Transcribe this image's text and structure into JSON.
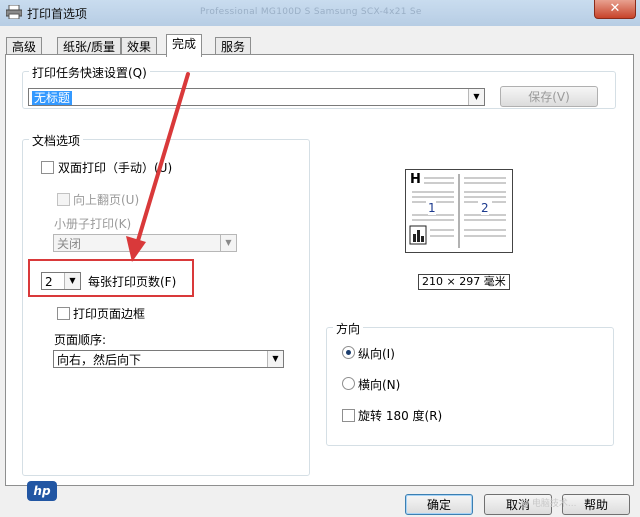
{
  "window": {
    "title": "打印首选项",
    "ghost_text": "Professional MG100D     S Samsung SCX-4x21 Se",
    "close_label": "✕"
  },
  "tabs": [
    {
      "label": "高级"
    },
    {
      "label": "纸张/质量"
    },
    {
      "label": "效果"
    },
    {
      "label": "完成",
      "active": true
    },
    {
      "label": "服务"
    }
  ],
  "quickset": {
    "group_label": "打印任务快速设置(Q)",
    "value": "无标题",
    "save_label": "保存(V)"
  },
  "doc_options": {
    "group_label": "文档选项",
    "duplex": {
      "label": "双面打印（手动）(U)",
      "checked": false
    },
    "flip_up": {
      "label": "向上翻页(U)",
      "checked": false
    },
    "booklet_label": "小册子打印(K)",
    "booklet_value": "关闭",
    "pages_per_sheet": {
      "value": "2",
      "label": "每张打印页数(F)"
    },
    "page_borders": {
      "label": "打印页面边框",
      "checked": false
    },
    "page_order_label": "页面顺序:",
    "page_order_value": "向右，然后向下"
  },
  "preview": {
    "header": "H",
    "page1": "1",
    "page2": "2",
    "size": "210 × 297 毫米"
  },
  "orientation": {
    "group_label": "方向",
    "portrait": "纵向(I)",
    "landscape": "横向(N)",
    "rotate": "旋转 180 度(R)",
    "selected": "portrait"
  },
  "footer": {
    "logo": "hp",
    "ok": "确定",
    "cancel": "取消",
    "help": "帮助",
    "watermark": "@ 电脑技术..."
  },
  "colors": {
    "accent_red": "#d9393a",
    "selection_blue": "#3399ff",
    "hp_blue": "#2256a3"
  }
}
